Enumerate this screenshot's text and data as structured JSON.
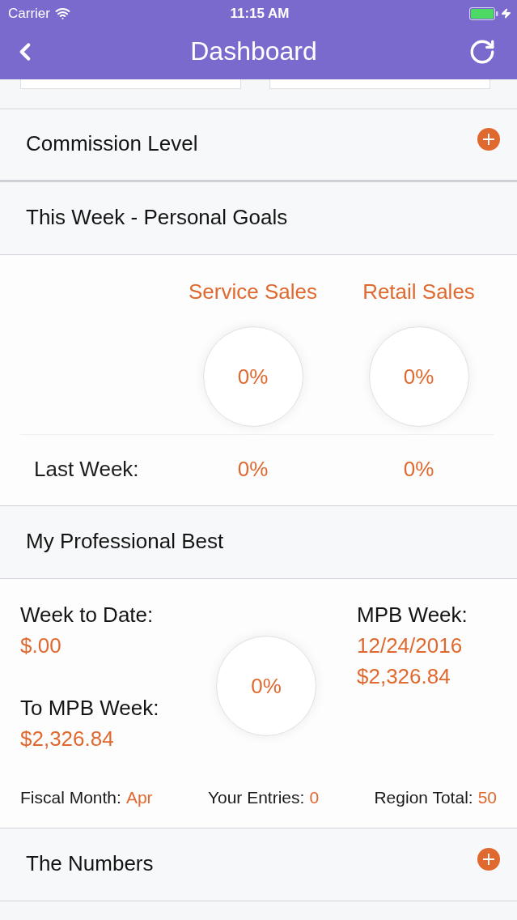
{
  "status_bar": {
    "carrier": "Carrier",
    "time": "11:15 AM"
  },
  "nav_bar": {
    "title": "Dashboard"
  },
  "sections": [
    {
      "kind": "header",
      "title": "Commission Level",
      "expanded": false
    },
    {
      "kind": "goals",
      "title": "This Week - Personal Goals",
      "expanded": true,
      "last_week_label": "Last Week:",
      "columns": [
        {
          "label": "Service Sales",
          "reading": "0%",
          "last_week": "0%"
        },
        {
          "label": "Retail Sales",
          "reading": "0%",
          "last_week": "0%"
        }
      ]
    },
    {
      "kind": "best",
      "title": "My Professional Best",
      "expanded": true,
      "reading": "0%",
      "left": [
        {
          "label": "Week to Date:",
          "values": [
            "$.00"
          ]
        },
        {
          "label": "To MPB Week:",
          "values": [
            "$2,326.84"
          ]
        }
      ],
      "right": [
        {
          "label": "MPB Week:",
          "values": [
            "12/24/2016",
            "$2,326.84"
          ]
        }
      ],
      "footer": [
        {
          "label": "Fiscal Month:",
          "value": "Apr"
        },
        {
          "label": "Your Entries:",
          "value": "0"
        },
        {
          "label": "Region Total:",
          "value": "50"
        }
      ]
    },
    {
      "kind": "header",
      "title": "The Numbers",
      "expanded": false
    }
  ]
}
